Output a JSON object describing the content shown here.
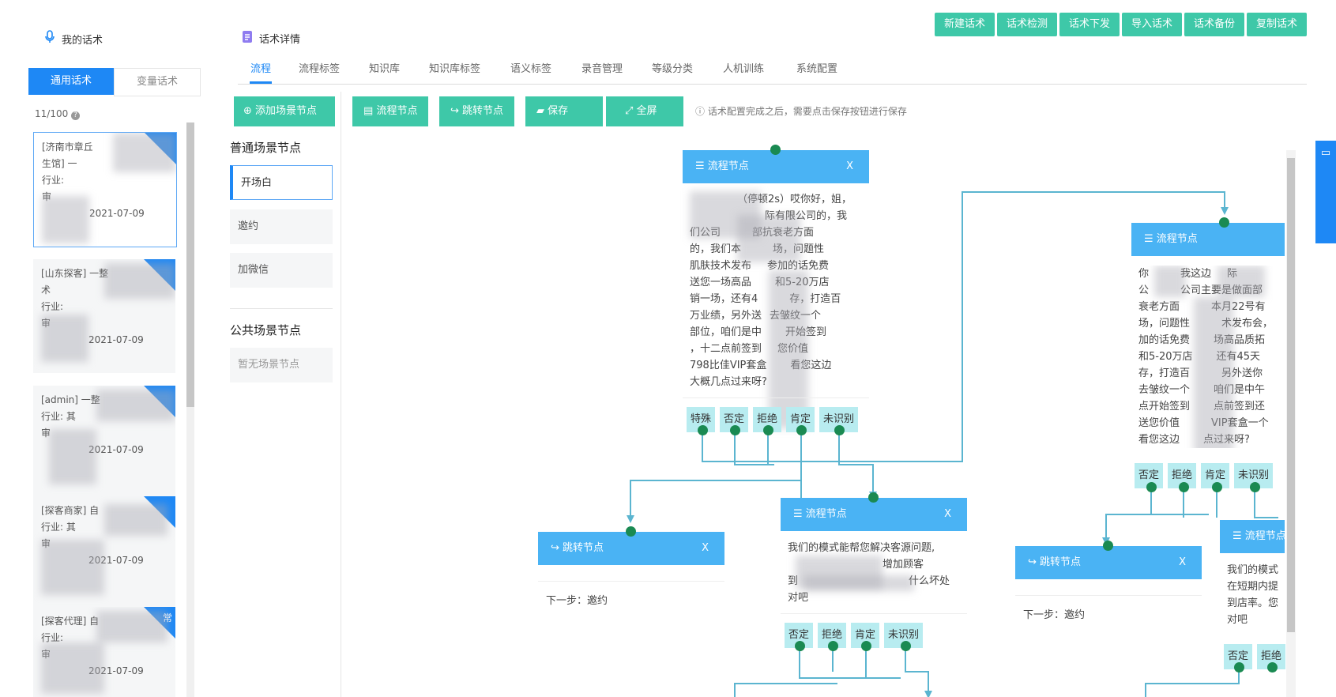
{
  "left": {
    "title": "我的话术",
    "tabs": [
      "通用话术",
      "变量话术"
    ],
    "count": "11/100",
    "cards": [
      {
        "l1": "[济南市章丘",
        "l2": "生馆] 一",
        "l3": "行业:",
        "l4": "审",
        "date": "2021-07-09"
      },
      {
        "l1": "[山东探客] 一整",
        "l2": "术",
        "l3": "行业:",
        "l4": "审",
        "date": "2021-07-09"
      },
      {
        "l1": "[admin] 一整",
        "l2": "行业: 其",
        "l3": "审",
        "l4": "",
        "date": "2021-07-09"
      },
      {
        "l1": "[探客商家] 自",
        "l2": "行业: 其",
        "l3": "审",
        "l4": "",
        "date": "2021-07-09"
      },
      {
        "l1": "[探客代理] 自",
        "l2": "行业:",
        "l3": "审",
        "l4": "",
        "date": "2021-07-09",
        "badge": "常"
      }
    ]
  },
  "detail": {
    "title": "话术详情",
    "toolbar": [
      "新建话术",
      "话术检测",
      "话术下发",
      "导入话术",
      "话术备份",
      "复制话术"
    ],
    "tabs": [
      "流程",
      "流程标签",
      "知识库",
      "知识库标签",
      "语义标签",
      "录音管理",
      "等级分类",
      "人机训练",
      "系统配置"
    ],
    "add_scene": "添加场景节点",
    "buttons": [
      "流程节点",
      "跳转节点",
      "保存",
      "全屏"
    ],
    "hint": "话术配置完成之后，需要点击保存按钮进行保存",
    "normal_scene_title": "普通场景节点",
    "normal_scenes": [
      "开场白",
      "邀约",
      "加微信"
    ],
    "public_scene_title": "公共场景节点",
    "public_empty": "暂无场景节点"
  },
  "canvas": {
    "node1": {
      "title": "流程节点",
      "close": "X",
      "lines": [
        "（停顿2s）哎你好，姐，",
        "际有限公司的，我",
        "们公司",
        "部抗衰老方面",
        "的，我们本",
        "场，问题性",
        "肌肤技术发布",
        "参加的话免费",
        "送您一场高品",
        "和5-20万店",
        "销一场，还有4",
        "存，打造百",
        "万业绩，另外送",
        "去皱纹一个",
        "部位，咱们是中",
        "开始签到",
        "，十二点前签到",
        "您价值",
        "798比佳VIP套盒",
        "看您这边",
        "大概几点过来呀?"
      ],
      "chips": [
        "特殊",
        "否定",
        "拒绝",
        "肯定",
        "未识别"
      ]
    },
    "node2": {
      "title": "流程节点",
      "close": "X",
      "lines": [
        "你",
        "我这边",
        "际",
        "公",
        "公司主要是做面部",
        "衰老方面",
        "本月22号有",
        "场，问题性",
        "术发布会，",
        "加的话免费",
        "场高品质拓",
        "和5-20万店",
        "还有45天",
        "存，打造百",
        "另外送你",
        "去皱纹一个",
        "咱们是中午",
        "点开始签到",
        "点前签到还",
        "送您价值",
        "VIP套盒一个",
        "看您这边",
        "点过来呀?"
      ],
      "chips": [
        "否定",
        "拒绝",
        "肯定",
        "未识别"
      ]
    },
    "node3": {
      "title": "流程节点",
      "close": "X",
      "lines": [
        "我们的模式能帮您解决客源问题,",
        "增加顾客",
        "到",
        "什么坏处",
        "对吧"
      ],
      "chips": [
        "否定",
        "拒绝",
        "肯定",
        "未识别"
      ]
    },
    "node4": {
      "title": "流程节点",
      "lines": [
        "我们的模式",
        "在短期内提",
        "到店率。您",
        "对吧"
      ],
      "chips": [
        "否定",
        "拒绝"
      ]
    },
    "jump1": {
      "title": "跳转节点",
      "close": "X",
      "next": "下一步：邀约"
    },
    "jump2": {
      "title": "跳转节点",
      "close": "X",
      "next": "下一步：邀约"
    }
  }
}
